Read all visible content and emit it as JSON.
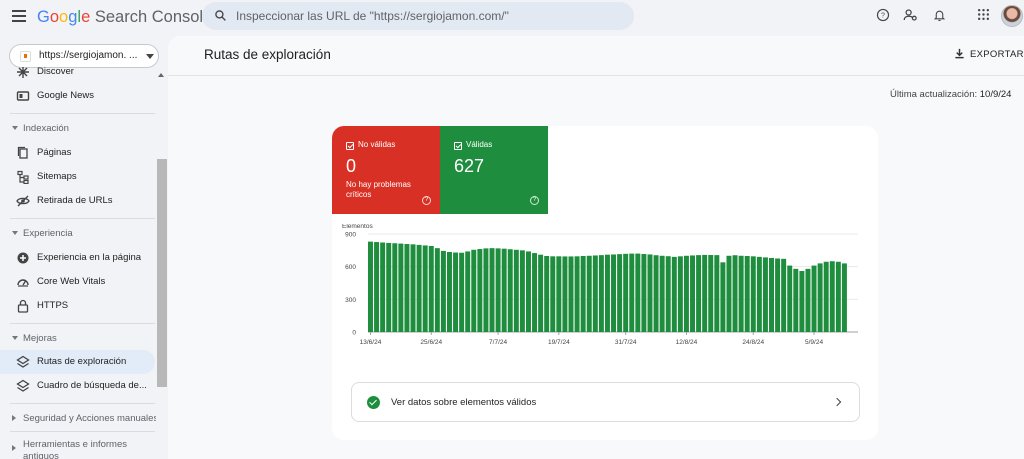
{
  "app": {
    "brand_google": "Google",
    "brand_product": "Search Console",
    "search_placeholder": "Inspeccionar las URL de \"https://sergiojamon.com/\""
  },
  "property": {
    "label": "https://sergiojamon. ..."
  },
  "sidebar": {
    "partial_top_label": "Discover",
    "items_top": [
      {
        "label": "Google News",
        "icon": "news-icon"
      }
    ],
    "sections": [
      {
        "label": "Indexación",
        "items": [
          {
            "label": "Páginas",
            "icon": "pages-icon"
          },
          {
            "label": "Sitemaps",
            "icon": "sitemap-icon"
          },
          {
            "label": "Retirada de URLs",
            "icon": "eye-off-icon"
          }
        ]
      },
      {
        "label": "Experiencia",
        "items": [
          {
            "label": "Experiencia en la página",
            "icon": "plus-circle-icon"
          },
          {
            "label": "Core Web Vitals",
            "icon": "gauge-icon"
          },
          {
            "label": "HTTPS",
            "icon": "lock-icon"
          }
        ]
      },
      {
        "label": "Mejoras",
        "items": [
          {
            "label": "Rutas de exploración",
            "icon": "layers-icon",
            "active": true
          },
          {
            "label": "Cuadro de búsqueda de...",
            "icon": "layers-icon"
          }
        ]
      }
    ],
    "collapsed_sections": [
      {
        "label": "Seguridad y Acciones manuales"
      },
      {
        "label": "Herramientas e informes antiguos"
      }
    ]
  },
  "main": {
    "title": "Rutas de exploración",
    "export_label": "EXPORTAR",
    "updated_prefix": "Última actualización:",
    "updated_date": "10/9/24",
    "tiles": {
      "invalid": {
        "label": "No válidas",
        "value": "0",
        "sub": "No hay problemas críticos",
        "color": "#d93025"
      },
      "valid": {
        "label": "Válidas",
        "value": "627",
        "color": "#1e8e3e"
      }
    },
    "details_link": "Ver datos sobre elementos válidos"
  },
  "chart_data": {
    "type": "bar",
    "title": "",
    "ylabel": "Elementos",
    "xlabel": "",
    "ylim": [
      0,
      900
    ],
    "yticks": [
      "900",
      "600",
      "300",
      "0"
    ],
    "xticks": [
      "13/6/24",
      "25/6/24",
      "7/7/24",
      "19/7/24",
      "31/7/24",
      "12/8/24",
      "24/8/24",
      "5/9/24"
    ],
    "bar_color": "#1e8e3e",
    "grid": true,
    "series": [
      {
        "values": [
          830,
          826,
          822,
          818,
          815,
          812,
          808,
          805,
          800,
          795,
          790,
          770,
          745,
          735,
          730,
          728,
          740,
          755,
          762,
          768,
          770,
          768,
          765,
          760,
          755,
          750,
          740,
          725,
          710,
          698,
          695,
          695,
          694,
          694,
          695,
          698,
          700,
          703,
          706,
          710,
          712,
          715,
          718,
          720,
          720,
          716,
          712,
          705,
          700,
          696,
          690,
          695,
          700,
          703,
          706,
          708,
          707,
          706,
          640,
          700,
          705,
          700,
          698,
          695,
          690,
          685,
          680,
          675,
          672,
          610,
          580,
          560,
          580,
          610,
          630,
          645,
          650,
          645,
          630
        ]
      }
    ]
  }
}
